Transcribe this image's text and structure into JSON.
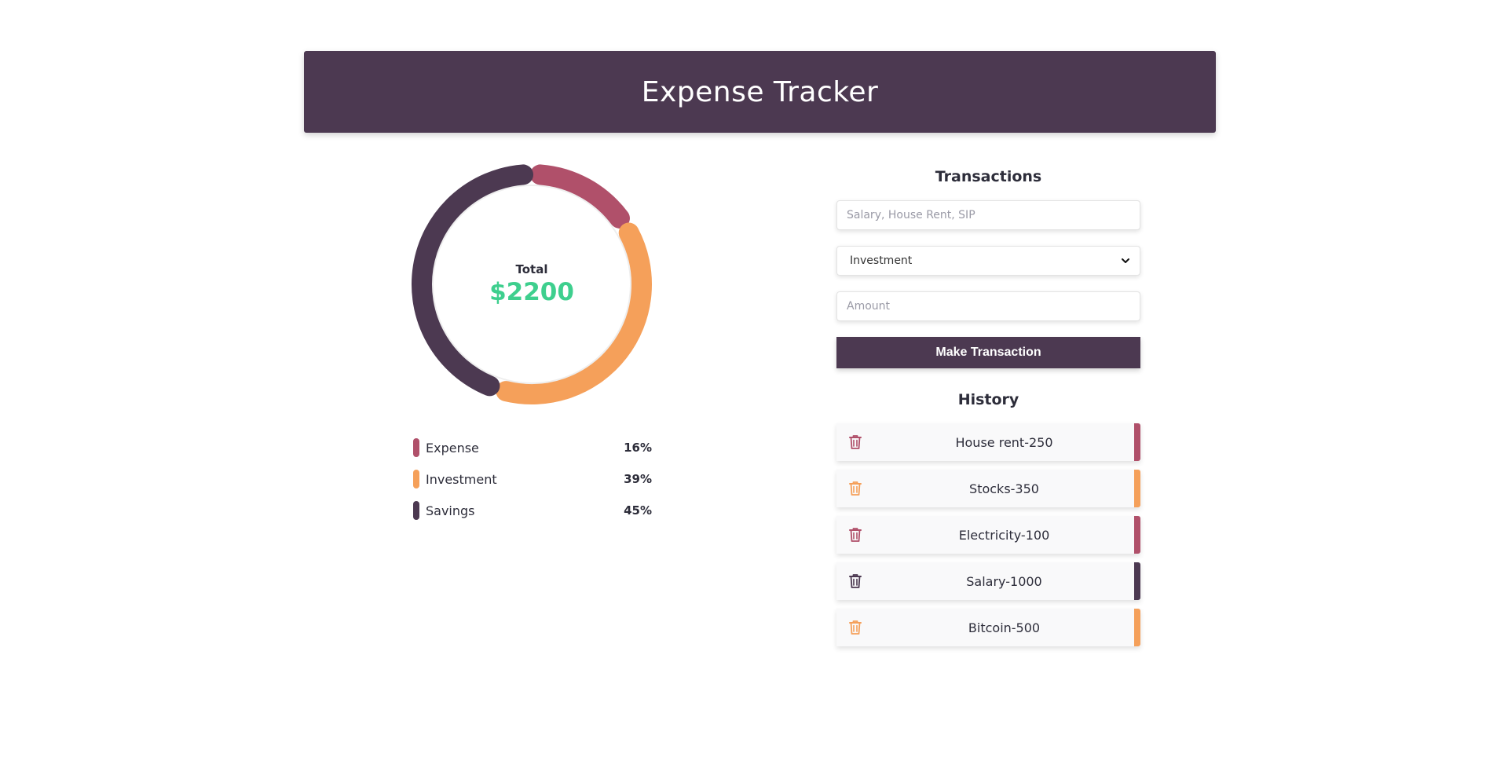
{
  "header": {
    "title": "Expense Tracker"
  },
  "summary": {
    "total_label": "Total",
    "total_value": "$2200"
  },
  "colors": {
    "expense": "#b0506a",
    "investment": "#f5a05a",
    "savings": "#4c3951",
    "accent_green": "#3ecf8e",
    "header_bg": "#4c3951"
  },
  "legend": [
    {
      "name": "Expense",
      "percent": "16%",
      "fraction": 0.16,
      "color": "#b0506a"
    },
    {
      "name": "Investment",
      "percent": "39%",
      "fraction": 0.39,
      "color": "#f5a05a"
    },
    {
      "name": "Savings",
      "percent": "45%",
      "fraction": 0.45,
      "color": "#4c3951"
    }
  ],
  "transactions": {
    "title": "Transactions",
    "name_placeholder": "Salary, House Rent, SIP",
    "type_selected": "Investment",
    "amount_placeholder": "Amount",
    "submit_label": "Make Transaction"
  },
  "history": {
    "title": "History",
    "items": [
      {
        "label": "House rent-250",
        "color": "#b0506a"
      },
      {
        "label": "Stocks-350",
        "color": "#f5a05a"
      },
      {
        "label": "Electricity-100",
        "color": "#b0506a"
      },
      {
        "label": "Salary-1000",
        "color": "#4c3951"
      },
      {
        "label": "Bitcoin-500",
        "color": "#f5a05a"
      }
    ]
  }
}
